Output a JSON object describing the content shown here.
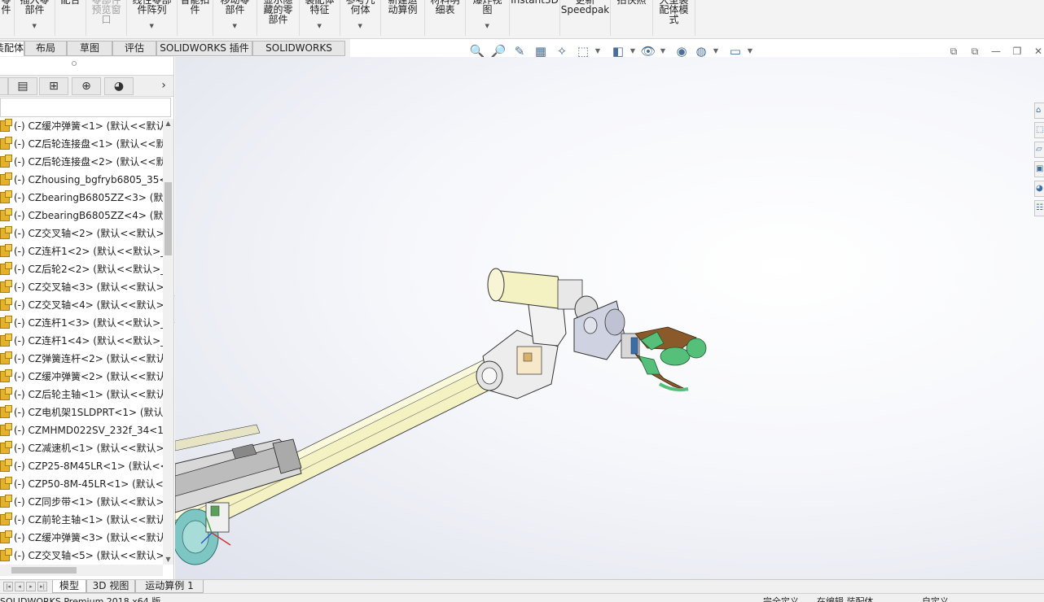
{
  "ribbon": {
    "buttons": [
      {
        "label": "零\n件",
        "dropdown": false,
        "disabled": false
      },
      {
        "label": "插入零\n部件",
        "dropdown": true,
        "disabled": false
      },
      {
        "label": "配合",
        "dropdown": false,
        "disabled": false
      },
      {
        "label": "零部件\n预览窗\n口",
        "dropdown": false,
        "disabled": true
      },
      {
        "label": "线性零部\n件阵列",
        "dropdown": true,
        "disabled": false
      },
      {
        "label": "智能扣\n件",
        "dropdown": false,
        "disabled": false
      },
      {
        "label": "移动零\n部件",
        "dropdown": true,
        "disabled": false
      },
      {
        "label": "显示隐\n藏的零\n部件",
        "dropdown": false,
        "disabled": false
      },
      {
        "label": "装配体\n特征",
        "dropdown": true,
        "disabled": false
      },
      {
        "label": "参考几\n何体",
        "dropdown": true,
        "disabled": false
      },
      {
        "label": "新建运\n动算例",
        "dropdown": false,
        "disabled": false
      },
      {
        "label": "材料明\n细表",
        "dropdown": false,
        "disabled": false
      },
      {
        "label": "爆炸视\n图",
        "dropdown": true,
        "disabled": false
      },
      {
        "label": "Instant3D",
        "dropdown": false,
        "disabled": false
      },
      {
        "label": "更新\nSpeedpak",
        "dropdown": false,
        "disabled": false
      },
      {
        "label": "拍快照",
        "dropdown": false,
        "disabled": false
      },
      {
        "label": "大型装\n配体模\n式",
        "dropdown": false,
        "disabled": false
      }
    ]
  },
  "command_tabs": [
    "装配体",
    "布局",
    "草图",
    "评估",
    "SOLIDWORKS 插件",
    "SOLIDWORKS MBD"
  ],
  "view_toolbar": {
    "icons": [
      "zoom-to-fit-icon",
      "zoom-to-area-icon",
      "previous-view-icon",
      "section-view-icon",
      "dynamic-annotation-icon",
      "view-orientation-icon",
      "display-style-icon",
      "hide-show-items-icon",
      "edit-appearance-icon",
      "apply-scene-icon",
      "view-settings-icon"
    ],
    "glyphs": [
      "🔍",
      "🔎",
      "✎",
      "▦",
      "✧",
      "⬚",
      "◧",
      "👁",
      "◉",
      "◍",
      "▭"
    ]
  },
  "window_buttons": [
    "⧉",
    "⧉",
    "—",
    "❐",
    "✕"
  ],
  "feature_manager": {
    "tab_icons": [
      "feature-tree-icon",
      "property-manager-icon",
      "configuration-manager-icon",
      "dimxpert-icon",
      "display-manager-icon"
    ],
    "tab_glyphs": [
      "☰",
      "▤",
      "⊞",
      "⊕",
      "◕"
    ],
    "more_glyph": "›",
    "items": [
      "(-) CZ缓冲弹簧<1> (默认<<默认:",
      "(-) CZ后轮连接盘<1> (默认<<默",
      "(-) CZ后轮连接盘<2> (默认<<默",
      "(-) CZhousing_bgfryb6805_35<2",
      "(-) CZbearingB6805ZZ<3> (默认",
      "(-) CZbearingB6805ZZ<4> (默认",
      "(-) CZ交叉轴<2> (默认<<默认>_",
      "(-) CZ连杆1<2> (默认<<默认>_显",
      "(-) CZ后轮2<2> (默认<<默认>_显",
      "(-) CZ交叉轴<3> (默认<<默认>_",
      "(-) CZ交叉轴<4> (默认<<默认>_",
      "(-) CZ连杆1<3> (默认<<默认>_显",
      "(-) CZ连杆1<4> (默认<<默认>_显",
      "(-) CZ弹簧连杆<2> (默认<<默认:",
      "(-) CZ缓冲弹簧<2> (默认<<默认:",
      "(-) CZ后轮主轴<1> (默认<<默认:",
      "(-) CZ电机架1SLDPRT<1> (默认<",
      "(-) CZMHMD022SV_232f_34<1>",
      "(-) CZ减速机<1> (默认<<默认>_",
      "(-) CZP25-8M45LR<1> (默认<<默",
      "(-) CZP50-8M-45LR<1> (默认<<",
      "(-) CZ同步带<1> (默认<<默认>_",
      "(-) CZ前轮主轴<1> (默认<<默认:",
      "(-) CZ缓冲弹簧<3> (默认<<默认:",
      "(-) CZ交叉轴<5> (默认<<默认>_"
    ]
  },
  "task_pane_icons": [
    "home-icon",
    "design-library-icon",
    "file-explorer-icon",
    "view-palette-icon",
    "appearances-icon",
    "custom-properties-icon"
  ],
  "task_pane_glyphs": [
    "⌂",
    "⬚",
    "▱",
    "▣",
    "◕",
    "☷"
  ],
  "bottom_tabs": [
    "模型",
    "3D 视图",
    "运动算例 1"
  ],
  "nav_glyphs": [
    "|◂",
    "◂",
    "▸",
    "▸|"
  ],
  "status_bar": {
    "app_name": "SOLIDWORKS Premium 2018 x64 版",
    "state": "完全定义",
    "mode": "在编辑 装配体",
    "units": "自定义"
  },
  "colors": {
    "arm_yellow": "#f4f1c2",
    "rail_gray": "#c6c6c6",
    "gripper_green": "#56c07a",
    "gripper_brown": "#8a5a2a",
    "accent_blue": "#3a6ea5"
  }
}
